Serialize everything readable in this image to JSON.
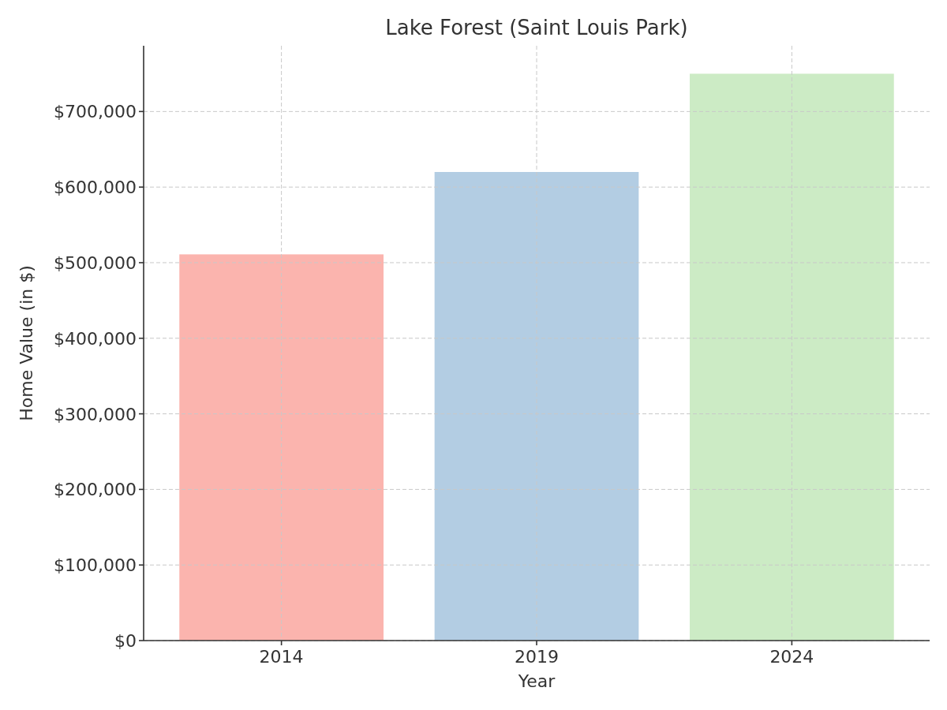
{
  "chart_data": {
    "type": "bar",
    "title": "Lake Forest (Saint Louis Park)",
    "xlabel": "Year",
    "ylabel": "Home Value (in $)",
    "categories": [
      "2014",
      "2019",
      "2024"
    ],
    "series": [
      {
        "colors": [
          "#fbb4ae",
          "#b3cde3",
          "#ccebc5"
        ],
        "values": [
          511000,
          620000,
          750000
        ]
      }
    ],
    "grid": true,
    "ylim": [
      0,
      787000
    ],
    "yticks": [
      {
        "value": 0,
        "label": "$0"
      },
      {
        "value": 100000,
        "label": "$100,000"
      },
      {
        "value": 200000,
        "label": "$200,000"
      },
      {
        "value": 300000,
        "label": "$300,000"
      },
      {
        "value": 400000,
        "label": "$400,000"
      },
      {
        "value": 500000,
        "label": "$500,000"
      },
      {
        "value": 600000,
        "label": "$600,000"
      },
      {
        "value": 700000,
        "label": "$700,000"
      }
    ]
  }
}
